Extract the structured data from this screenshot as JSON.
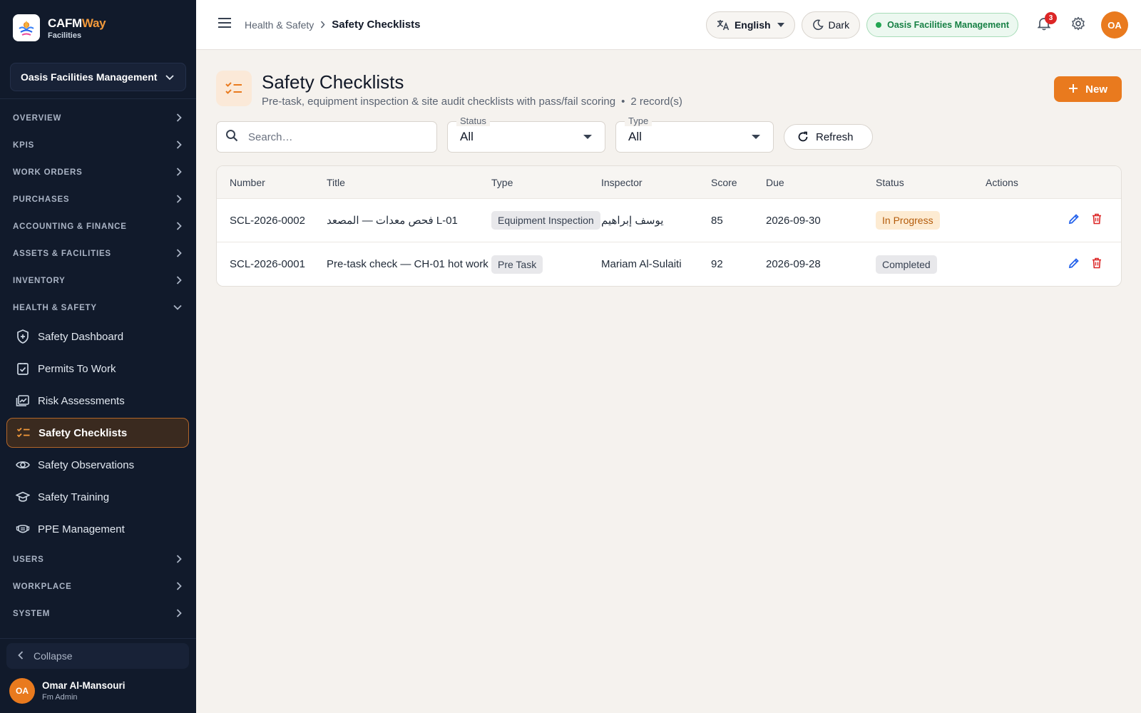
{
  "brand": {
    "name_main": "CAFM",
    "name_accent": "Way",
    "sub": "Facilities"
  },
  "sidebar": {
    "org_selector": "Oasis Facilities Management",
    "sections_top": [
      {
        "label": "OVERVIEW"
      },
      {
        "label": "KPIS"
      },
      {
        "label": "WORK ORDERS"
      },
      {
        "label": "PURCHASES"
      },
      {
        "label": "ACCOUNTING & FINANCE"
      },
      {
        "label": "ASSETS & FACILITIES"
      },
      {
        "label": "INVENTORY"
      },
      {
        "label": "HEALTH & SAFETY"
      }
    ],
    "items": [
      {
        "label": "Safety Dashboard",
        "icon": "shield-plus-icon"
      },
      {
        "label": "Permits To Work",
        "icon": "checkbox-clipboard-icon"
      },
      {
        "label": "Risk Assessments",
        "icon": "chart-image-icon"
      },
      {
        "label": "Safety Checklists",
        "icon": "checklist-icon",
        "active": true
      },
      {
        "label": "Safety Observations",
        "icon": "eye-icon"
      },
      {
        "label": "Safety Training",
        "icon": "graduation-cap-icon"
      },
      {
        "label": "PPE Management",
        "icon": "mask-icon"
      }
    ],
    "sections_bottom": [
      {
        "label": "USERS"
      },
      {
        "label": "WORKPLACE"
      },
      {
        "label": "SYSTEM"
      }
    ],
    "collapse_label": "Collapse",
    "user": {
      "initials": "OA",
      "name": "Omar Al-Mansouri",
      "role": "Fm Admin"
    }
  },
  "topbar": {
    "breadcrumb_parent": "Health & Safety",
    "breadcrumb_current": "Safety Checklists",
    "language": "English",
    "theme": "Dark",
    "org_status": "Oasis Facilities Management",
    "notifications_count": "3",
    "avatar_initials": "OA"
  },
  "page": {
    "title": "Safety Checklists",
    "subtitle": "Pre-task, equipment inspection & site audit checklists with pass/fail scoring",
    "record_count": "2 record(s)",
    "new_button": "New"
  },
  "filters": {
    "search_placeholder": "Search…",
    "status_label": "Status",
    "status_value": "All",
    "type_label": "Type",
    "type_value": "All",
    "refresh_label": "Refresh"
  },
  "table": {
    "headers": {
      "number": "Number",
      "title": "Title",
      "type": "Type",
      "inspector": "Inspector",
      "score": "Score",
      "due": "Due",
      "status": "Status",
      "actions": "Actions"
    },
    "rows": [
      {
        "number": "SCL-2026-0002",
        "title": "فحص معدات — المصعد L-01",
        "type": "Equipment Inspection",
        "inspector": "يوسف إبراهيم",
        "score": "85",
        "due": "2026-09-30",
        "status": "In Progress"
      },
      {
        "number": "SCL-2026-0001",
        "title": "Pre-task check — CH-01 hot work",
        "type": "Pre Task",
        "inspector": "Mariam Al-Sulaiti",
        "score": "92",
        "due": "2026-09-28",
        "status": "Completed"
      }
    ]
  },
  "colors": {
    "accent": "#e97a1e",
    "sidebar_bg": "#111a2b",
    "in_progress_text": "#b45b0a",
    "edit_icon": "#2563eb",
    "delete_icon": "#dc2626",
    "org_status_green": "#168044"
  }
}
